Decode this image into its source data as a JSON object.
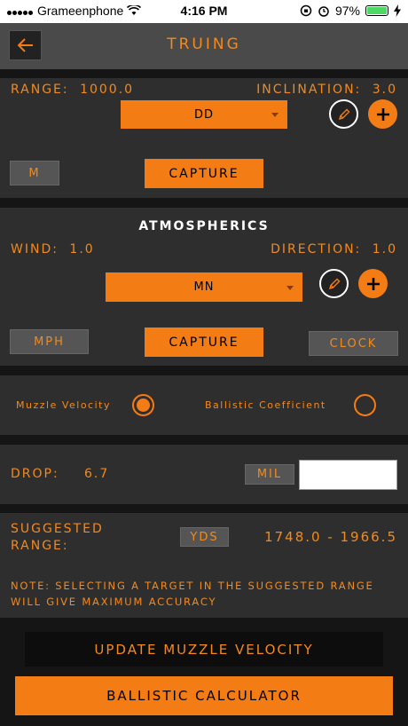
{
  "status_bar": {
    "carrier": "Grameenphone",
    "time": "4:16 PM",
    "battery": "97%"
  },
  "header": {
    "title": "TRUING"
  },
  "truing": {
    "range_label": "Range:",
    "range_value": "1000.0",
    "inclination_label": "Inclination:",
    "inclination_value": "3.0",
    "dropdown_value": "DD",
    "unit": "M",
    "capture_label": "CAPTURE"
  },
  "atmospherics": {
    "title": "ATMOSPHERICS",
    "wind_label": "Wind:",
    "wind_value": "1.0",
    "direction_label": "Direction:",
    "direction_value": "1.0",
    "dropdown_value": "MN",
    "speed_unit": "MPH",
    "capture_label": "CAPTURE",
    "direction_unit": "CLOCK"
  },
  "mode": {
    "muzzle_velocity_label": "Muzzle Velocity",
    "ballistic_coefficient_label": "Ballistic Coefficient",
    "selected": "muzzle_velocity"
  },
  "drop": {
    "label": "Drop:",
    "value": "6.7",
    "unit": "MIL",
    "input_value": ""
  },
  "suggested": {
    "label_line1": "Suggested",
    "label_line2": "Range:",
    "unit": "YDS",
    "range": "1748.0 - 1966.5",
    "note": "NOTE: Selecting a target in the suggested range will give maximum accuracy"
  },
  "actions": {
    "update_label": "Update Muzzle Velocity",
    "calculator_label": "BALLISTIC CALCULATOR"
  },
  "colors": {
    "accent": "#f47c14",
    "panel": "#2e2e2e",
    "background": "#151515"
  }
}
